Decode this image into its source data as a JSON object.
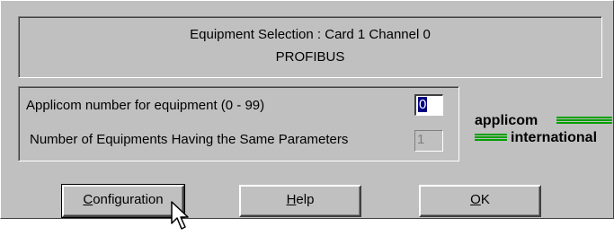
{
  "header": {
    "title": "Equipment Selection : Card 1 Channel 0",
    "protocol": "PROFIBUS"
  },
  "params": {
    "number_label": "Applicom number for equipment (0 - 99)",
    "number_value": "0",
    "same_params_label": "Number of Equipments Having the Same Parameters",
    "same_params_value": "1"
  },
  "logo": {
    "line1": "applicom",
    "line2": "international"
  },
  "buttons": {
    "configuration": {
      "mnemonic": "C",
      "rest": "onfiguration"
    },
    "help": {
      "mnemonic": "H",
      "rest": "elp"
    },
    "ok": {
      "mnemonic": "O",
      "rest": "K"
    }
  },
  "colors": {
    "dialog_bg": "#c0c0c0",
    "selection": "#000080",
    "logo_green": "#00a000"
  },
  "icons": [
    "arrow-cursor-icon"
  ]
}
